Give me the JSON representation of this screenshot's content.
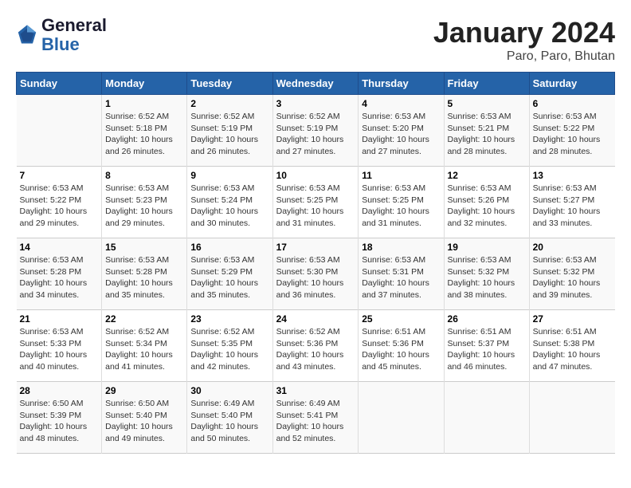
{
  "logo": {
    "text_general": "General",
    "text_blue": "Blue"
  },
  "title": "January 2024",
  "subtitle": "Paro, Paro, Bhutan",
  "days_of_week": [
    "Sunday",
    "Monday",
    "Tuesday",
    "Wednesday",
    "Thursday",
    "Friday",
    "Saturday"
  ],
  "weeks": [
    [
      {
        "num": "",
        "sunrise": "",
        "sunset": "",
        "daylight": ""
      },
      {
        "num": "1",
        "sunrise": "Sunrise: 6:52 AM",
        "sunset": "Sunset: 5:18 PM",
        "daylight": "Daylight: 10 hours and 26 minutes."
      },
      {
        "num": "2",
        "sunrise": "Sunrise: 6:52 AM",
        "sunset": "Sunset: 5:19 PM",
        "daylight": "Daylight: 10 hours and 26 minutes."
      },
      {
        "num": "3",
        "sunrise": "Sunrise: 6:52 AM",
        "sunset": "Sunset: 5:19 PM",
        "daylight": "Daylight: 10 hours and 27 minutes."
      },
      {
        "num": "4",
        "sunrise": "Sunrise: 6:53 AM",
        "sunset": "Sunset: 5:20 PM",
        "daylight": "Daylight: 10 hours and 27 minutes."
      },
      {
        "num": "5",
        "sunrise": "Sunrise: 6:53 AM",
        "sunset": "Sunset: 5:21 PM",
        "daylight": "Daylight: 10 hours and 28 minutes."
      },
      {
        "num": "6",
        "sunrise": "Sunrise: 6:53 AM",
        "sunset": "Sunset: 5:22 PM",
        "daylight": "Daylight: 10 hours and 28 minutes."
      }
    ],
    [
      {
        "num": "7",
        "sunrise": "Sunrise: 6:53 AM",
        "sunset": "Sunset: 5:22 PM",
        "daylight": "Daylight: 10 hours and 29 minutes."
      },
      {
        "num": "8",
        "sunrise": "Sunrise: 6:53 AM",
        "sunset": "Sunset: 5:23 PM",
        "daylight": "Daylight: 10 hours and 29 minutes."
      },
      {
        "num": "9",
        "sunrise": "Sunrise: 6:53 AM",
        "sunset": "Sunset: 5:24 PM",
        "daylight": "Daylight: 10 hours and 30 minutes."
      },
      {
        "num": "10",
        "sunrise": "Sunrise: 6:53 AM",
        "sunset": "Sunset: 5:25 PM",
        "daylight": "Daylight: 10 hours and 31 minutes."
      },
      {
        "num": "11",
        "sunrise": "Sunrise: 6:53 AM",
        "sunset": "Sunset: 5:25 PM",
        "daylight": "Daylight: 10 hours and 31 minutes."
      },
      {
        "num": "12",
        "sunrise": "Sunrise: 6:53 AM",
        "sunset": "Sunset: 5:26 PM",
        "daylight": "Daylight: 10 hours and 32 minutes."
      },
      {
        "num": "13",
        "sunrise": "Sunrise: 6:53 AM",
        "sunset": "Sunset: 5:27 PM",
        "daylight": "Daylight: 10 hours and 33 minutes."
      }
    ],
    [
      {
        "num": "14",
        "sunrise": "Sunrise: 6:53 AM",
        "sunset": "Sunset: 5:28 PM",
        "daylight": "Daylight: 10 hours and 34 minutes."
      },
      {
        "num": "15",
        "sunrise": "Sunrise: 6:53 AM",
        "sunset": "Sunset: 5:28 PM",
        "daylight": "Daylight: 10 hours and 35 minutes."
      },
      {
        "num": "16",
        "sunrise": "Sunrise: 6:53 AM",
        "sunset": "Sunset: 5:29 PM",
        "daylight": "Daylight: 10 hours and 35 minutes."
      },
      {
        "num": "17",
        "sunrise": "Sunrise: 6:53 AM",
        "sunset": "Sunset: 5:30 PM",
        "daylight": "Daylight: 10 hours and 36 minutes."
      },
      {
        "num": "18",
        "sunrise": "Sunrise: 6:53 AM",
        "sunset": "Sunset: 5:31 PM",
        "daylight": "Daylight: 10 hours and 37 minutes."
      },
      {
        "num": "19",
        "sunrise": "Sunrise: 6:53 AM",
        "sunset": "Sunset: 5:32 PM",
        "daylight": "Daylight: 10 hours and 38 minutes."
      },
      {
        "num": "20",
        "sunrise": "Sunrise: 6:53 AM",
        "sunset": "Sunset: 5:32 PM",
        "daylight": "Daylight: 10 hours and 39 minutes."
      }
    ],
    [
      {
        "num": "21",
        "sunrise": "Sunrise: 6:53 AM",
        "sunset": "Sunset: 5:33 PM",
        "daylight": "Daylight: 10 hours and 40 minutes."
      },
      {
        "num": "22",
        "sunrise": "Sunrise: 6:52 AM",
        "sunset": "Sunset: 5:34 PM",
        "daylight": "Daylight: 10 hours and 41 minutes."
      },
      {
        "num": "23",
        "sunrise": "Sunrise: 6:52 AM",
        "sunset": "Sunset: 5:35 PM",
        "daylight": "Daylight: 10 hours and 42 minutes."
      },
      {
        "num": "24",
        "sunrise": "Sunrise: 6:52 AM",
        "sunset": "Sunset: 5:36 PM",
        "daylight": "Daylight: 10 hours and 43 minutes."
      },
      {
        "num": "25",
        "sunrise": "Sunrise: 6:51 AM",
        "sunset": "Sunset: 5:36 PM",
        "daylight": "Daylight: 10 hours and 45 minutes."
      },
      {
        "num": "26",
        "sunrise": "Sunrise: 6:51 AM",
        "sunset": "Sunset: 5:37 PM",
        "daylight": "Daylight: 10 hours and 46 minutes."
      },
      {
        "num": "27",
        "sunrise": "Sunrise: 6:51 AM",
        "sunset": "Sunset: 5:38 PM",
        "daylight": "Daylight: 10 hours and 47 minutes."
      }
    ],
    [
      {
        "num": "28",
        "sunrise": "Sunrise: 6:50 AM",
        "sunset": "Sunset: 5:39 PM",
        "daylight": "Daylight: 10 hours and 48 minutes."
      },
      {
        "num": "29",
        "sunrise": "Sunrise: 6:50 AM",
        "sunset": "Sunset: 5:40 PM",
        "daylight": "Daylight: 10 hours and 49 minutes."
      },
      {
        "num": "30",
        "sunrise": "Sunrise: 6:49 AM",
        "sunset": "Sunset: 5:40 PM",
        "daylight": "Daylight: 10 hours and 50 minutes."
      },
      {
        "num": "31",
        "sunrise": "Sunrise: 6:49 AM",
        "sunset": "Sunset: 5:41 PM",
        "daylight": "Daylight: 10 hours and 52 minutes."
      },
      {
        "num": "",
        "sunrise": "",
        "sunset": "",
        "daylight": ""
      },
      {
        "num": "",
        "sunrise": "",
        "sunset": "",
        "daylight": ""
      },
      {
        "num": "",
        "sunrise": "",
        "sunset": "",
        "daylight": ""
      }
    ]
  ]
}
